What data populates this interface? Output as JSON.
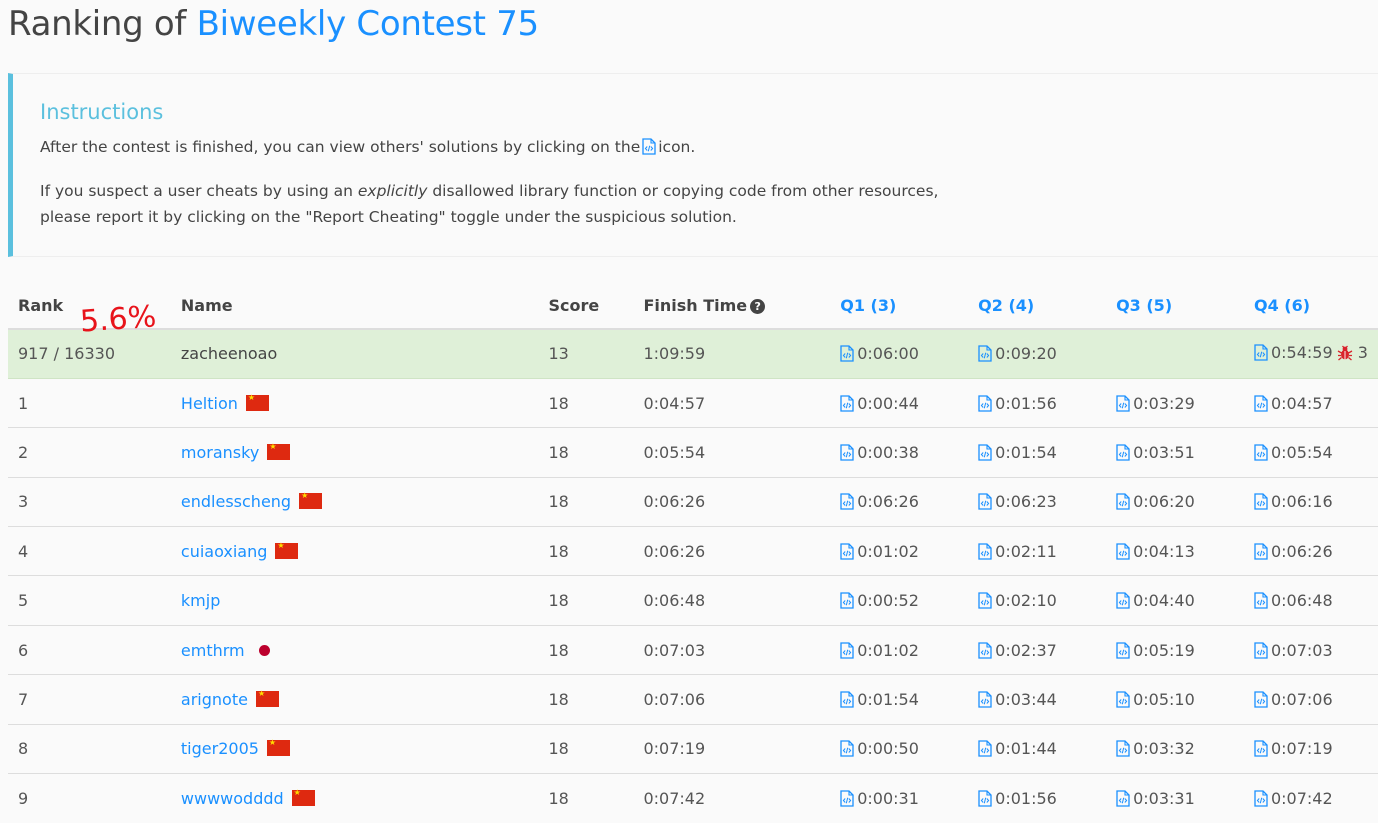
{
  "header": {
    "prefix": "Ranking of",
    "contest": "Biweekly Contest 75"
  },
  "instructions": {
    "title": "Instructions",
    "line1_before": "After the contest is finished, you can view others' solutions by clicking on the",
    "line1_after": "icon.",
    "line2_a": "If you suspect a user cheats by using an",
    "line2_em": "explicitly",
    "line2_b": "disallowed library function or copying code from other resources,",
    "line3": "please report it by clicking on the \"Report Cheating\" toggle under the suspicious solution."
  },
  "annotation": "5.6%",
  "columns": {
    "rank": "Rank",
    "name": "Name",
    "score": "Score",
    "finish": "Finish Time",
    "help_icon": "?",
    "q1": "Q1 (3)",
    "q2": "Q2 (4)",
    "q3": "Q3 (5)",
    "q4": "Q4 (6)"
  },
  "me": {
    "rank": "917 / 16330",
    "name": "zacheenoao",
    "score": "13",
    "finish": "1:09:59",
    "q1": "0:06:00",
    "q2": "0:09:20",
    "q3": "",
    "q4": "0:54:59",
    "penalty": "3"
  },
  "rows": [
    {
      "rank": "1",
      "name": "Heltion",
      "flag": "cn",
      "score": "18",
      "finish": "0:04:57",
      "q1": "0:00:44",
      "q2": "0:01:56",
      "q3": "0:03:29",
      "q4": "0:04:57"
    },
    {
      "rank": "2",
      "name": "moransky",
      "flag": "cn",
      "score": "18",
      "finish": "0:05:54",
      "q1": "0:00:38",
      "q2": "0:01:54",
      "q3": "0:03:51",
      "q4": "0:05:54"
    },
    {
      "rank": "3",
      "name": "endlesscheng",
      "flag": "cn",
      "score": "18",
      "finish": "0:06:26",
      "q1": "0:06:26",
      "q2": "0:06:23",
      "q3": "0:06:20",
      "q4": "0:06:16"
    },
    {
      "rank": "4",
      "name": "cuiaoxiang",
      "flag": "cn",
      "score": "18",
      "finish": "0:06:26",
      "q1": "0:01:02",
      "q2": "0:02:11",
      "q3": "0:04:13",
      "q4": "0:06:26"
    },
    {
      "rank": "5",
      "name": "kmjp",
      "flag": "",
      "score": "18",
      "finish": "0:06:48",
      "q1": "0:00:52",
      "q2": "0:02:10",
      "q3": "0:04:40",
      "q4": "0:06:48"
    },
    {
      "rank": "6",
      "name": "emthrm",
      "flag": "jp",
      "score": "18",
      "finish": "0:07:03",
      "q1": "0:01:02",
      "q2": "0:02:37",
      "q3": "0:05:19",
      "q4": "0:07:03"
    },
    {
      "rank": "7",
      "name": "arignote",
      "flag": "cn",
      "score": "18",
      "finish": "0:07:06",
      "q1": "0:01:54",
      "q2": "0:03:44",
      "q3": "0:05:10",
      "q4": "0:07:06"
    },
    {
      "rank": "8",
      "name": "tiger2005",
      "flag": "cn",
      "score": "18",
      "finish": "0:07:19",
      "q1": "0:00:50",
      "q2": "0:01:44",
      "q3": "0:03:32",
      "q4": "0:07:19"
    },
    {
      "rank": "9",
      "name": "wwwwodddd",
      "flag": "cn",
      "score": "18",
      "finish": "0:07:42",
      "q1": "0:00:31",
      "q2": "0:01:56",
      "q3": "0:03:31",
      "q4": "0:07:42"
    }
  ],
  "icons": {
    "solution": "code-file-icon",
    "bug": "bug-icon",
    "help": "question-circle-icon"
  },
  "colors": {
    "accent": "#1a90ff",
    "info": "#5bc0de",
    "highlight_row": "#dff0d8",
    "annotation": "#e8131b"
  }
}
